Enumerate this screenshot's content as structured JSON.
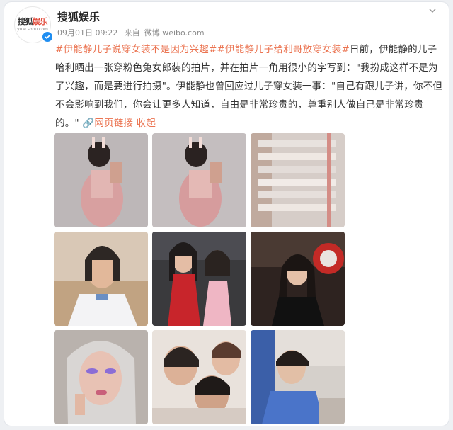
{
  "post": {
    "author": "搜狐娱乐",
    "avatar_logo_text_1": "搜狐",
    "avatar_logo_text_2": "娱乐",
    "avatar_logo_url": "yule.sohu.com",
    "date": "09月01日 09:22",
    "source_prefix": "来自",
    "source": "微博 weibo.com",
    "topic_1": "#伊能静儿子说穿女装不是因为兴趣#",
    "topic_2": "#伊能静儿子给利哥放穿女装#",
    "body": "日前，伊能静的儿子哈利晒出一张穿粉色兔女郎装的拍片，并在拍片一角用很小的字写到：\"我扮成这样不是为了兴趣，而是要进行拍摄\"。伊能静也曾回应过儿子穿女装一事：\"自己有跟儿子讲，你不但不会影响到我们，你会让更多人知道，自由是非常珍贵的，尊重别人做自己是非常珍贵的。\"",
    "link_text": "网页链接",
    "collapse_text": "收起"
  },
  "colors": {
    "accent": "#eb7350",
    "verified": "#1f8ef1"
  }
}
